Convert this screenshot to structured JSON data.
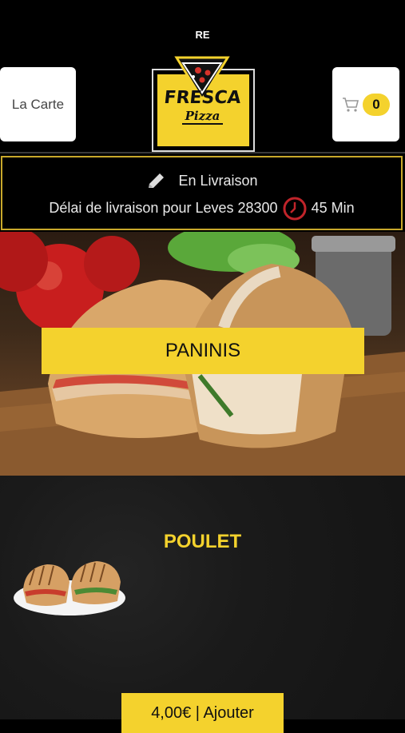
{
  "status": {
    "carrier": "RE"
  },
  "header": {
    "menu_label": "La Carte",
    "cart_count": "0",
    "logo_title": "FRESCA",
    "logo_subtitle": "Pizza"
  },
  "delivery": {
    "mode": "En Livraison",
    "delay_text": "Délai de livraison pour Leves 28300",
    "delay_time": "45 Min"
  },
  "hero": {
    "category": "PANINIS"
  },
  "section": {
    "title": "POULET",
    "add_button": "4,00€ | Ajouter"
  },
  "colors": {
    "accent": "#f4d22d",
    "background": "#000000",
    "border": "#c9a92b"
  }
}
